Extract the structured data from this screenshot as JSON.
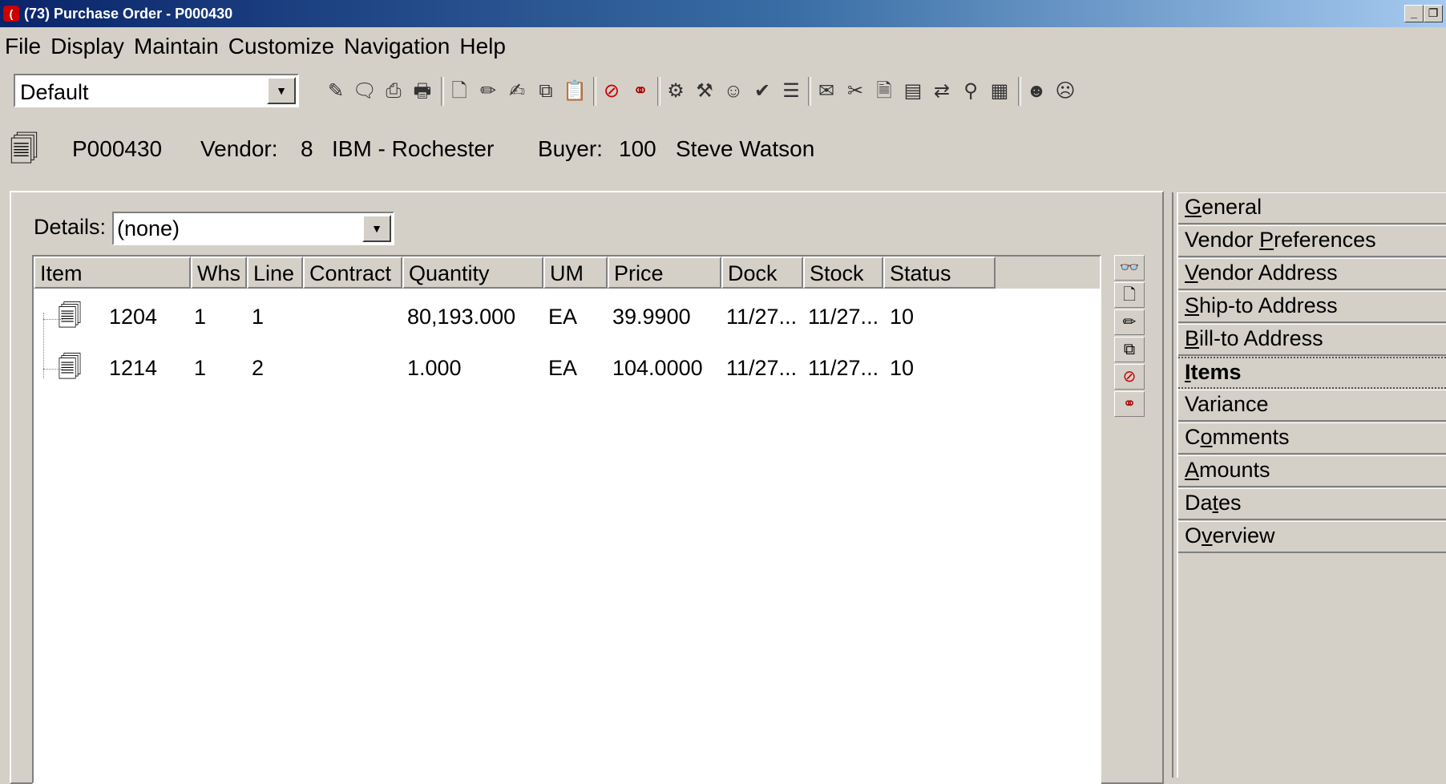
{
  "window": {
    "title": "(73) Purchase Order - P000430",
    "app_icon": "(",
    "minimize": "_",
    "restore": "❐"
  },
  "menu": [
    "File",
    "Display",
    "Maintain",
    "Customize",
    "Navigation",
    "Help"
  ],
  "toolbar": {
    "view_select": "Default",
    "icons": [
      "notes-icon",
      "memo-icon",
      "print-preview-icon",
      "print-icon",
      "new-icon",
      "edit-icon",
      "edit-alt-icon",
      "copy-icon",
      "paste-icon",
      "cancel-icon",
      "link-icon",
      "receive-icon",
      "process-icon",
      "vendor-icon",
      "approve-icon",
      "review-icon",
      "attach-icon",
      "tools-icon",
      "document-icon",
      "report-icon",
      "transfer-icon",
      "inquiry-icon",
      "chart-icon",
      "user-icon",
      "users-icon"
    ]
  },
  "header": {
    "po_number": "P000430",
    "vendor_label": "Vendor:",
    "vendor_code": "8",
    "vendor_name": "IBM - Rochester",
    "buyer_label": "Buyer:",
    "buyer_code": "100",
    "buyer_name": "Steve Watson"
  },
  "details": {
    "label": "Details:",
    "value": "(none)"
  },
  "table": {
    "columns": [
      "Item",
      "Whs",
      "Line",
      "Contract",
      "Quantity",
      "UM",
      "Price",
      "Dock",
      "Stock",
      "Status"
    ],
    "rows": [
      {
        "item": "1204",
        "whs": "1",
        "line": "1",
        "contract": "",
        "quantity": "80,193.000",
        "um": "EA",
        "price": "39.9900",
        "dock": "11/27...",
        "stock": "11/27...",
        "status": "10"
      },
      {
        "item": "1214",
        "whs": "1",
        "line": "2",
        "contract": "",
        "quantity": "1.000",
        "um": "EA",
        "price": "104.0000",
        "dock": "11/27...",
        "stock": "11/27...",
        "status": "10"
      }
    ]
  },
  "side_toolbar": [
    "view-icon",
    "new-icon",
    "edit-icon",
    "copy-icon",
    "cancel-icon",
    "link-icon"
  ],
  "tabs": [
    {
      "pre": "",
      "ul": "G",
      "post": "eneral",
      "active": false
    },
    {
      "pre": "Vendor ",
      "ul": "P",
      "post": "references",
      "active": false
    },
    {
      "pre": "",
      "ul": "V",
      "post": "endor Address",
      "active": false
    },
    {
      "pre": "",
      "ul": "S",
      "post": "hip-to Address",
      "active": false
    },
    {
      "pre": "",
      "ul": "B",
      "post": "ill-to Address",
      "active": false
    },
    {
      "pre": "",
      "ul": "I",
      "post": "tems",
      "active": true
    },
    {
      "pre": "Variance",
      "ul": "",
      "post": "",
      "active": false
    },
    {
      "pre": "C",
      "ul": "o",
      "post": "mments",
      "active": false
    },
    {
      "pre": "",
      "ul": "A",
      "post": "mounts",
      "active": false
    },
    {
      "pre": "Da",
      "ul": "t",
      "post": "es",
      "active": false
    },
    {
      "pre": "O",
      "ul": "v",
      "post": "erview",
      "active": false
    }
  ]
}
